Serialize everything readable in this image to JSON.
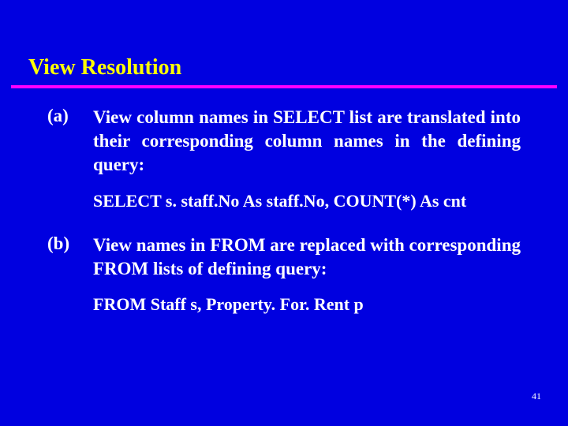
{
  "title": "View Resolution",
  "items": [
    {
      "marker": "(a)",
      "body": "View column names in SELECT list are translated into their corresponding column names in the defining query:",
      "code": "SELECT s. staff.No As staff.No, COUNT(*) As cnt"
    },
    {
      "marker": "(b)",
      "body": "View names in FROM are replaced with corresponding FROM lists of defining query:",
      "code": "FROM Staff s, Property. For. Rent p"
    }
  ],
  "page_number": "41"
}
